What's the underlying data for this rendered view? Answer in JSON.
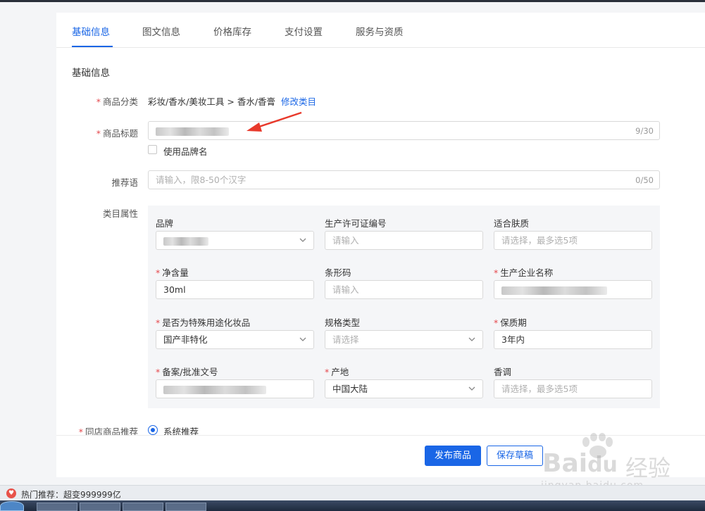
{
  "tabs": [
    {
      "label": "基础信息"
    },
    {
      "label": "图文信息"
    },
    {
      "label": "价格库存"
    },
    {
      "label": "支付设置"
    },
    {
      "label": "服务与资质"
    }
  ],
  "section_title": "基础信息",
  "category": {
    "label": "商品分类",
    "path": "彩妆/香水/美妆工具 > 香水/香膏",
    "edit_link": "修改类目"
  },
  "title": {
    "label": "商品标题",
    "counter": "9/30",
    "use_brand_label": "使用品牌名"
  },
  "slogan": {
    "label": "推荐语",
    "placeholder": "请输入，限8-50个汉字",
    "counter": "0/50"
  },
  "attributes": {
    "label": "类目属性",
    "fields": {
      "brand": {
        "label": "品牌"
      },
      "license_no": {
        "label": "生产许可证编号",
        "placeholder": "请输入"
      },
      "skin_type": {
        "label": "适合肤质",
        "placeholder": "请选择，最多选5项"
      },
      "net_content": {
        "label": "净含量",
        "value": "30ml"
      },
      "barcode": {
        "label": "条形码",
        "placeholder": "请输入"
      },
      "manufacturer": {
        "label": "生产企业名称"
      },
      "special_use": {
        "label": "是否为特殊用途化妆品",
        "value": "国产非特化"
      },
      "spec_type": {
        "label": "规格类型",
        "placeholder": "请选择"
      },
      "shelf_life": {
        "label": "保质期",
        "value": "3年内"
      },
      "filing_no": {
        "label": "备案/批准文号"
      },
      "origin": {
        "label": "产地",
        "value": "中国大陆"
      },
      "scent": {
        "label": "香调",
        "placeholder": "请选择，最多选5项"
      }
    }
  },
  "recommend": {
    "label": "同店商品推荐",
    "option": "系统推荐"
  },
  "buttons": {
    "publish": "发布商品",
    "save_draft": "保存草稿"
  },
  "status_bar": {
    "text": "热门推荐：超变999999亿"
  },
  "watermark": {
    "brand": "Bai",
    "brand2": "du",
    "cn": "经验",
    "url": "jingyan.baidu.com"
  },
  "colors": {
    "accent": "#1a66e6",
    "required": "#e5484d",
    "arrow": "#e8392b"
  }
}
